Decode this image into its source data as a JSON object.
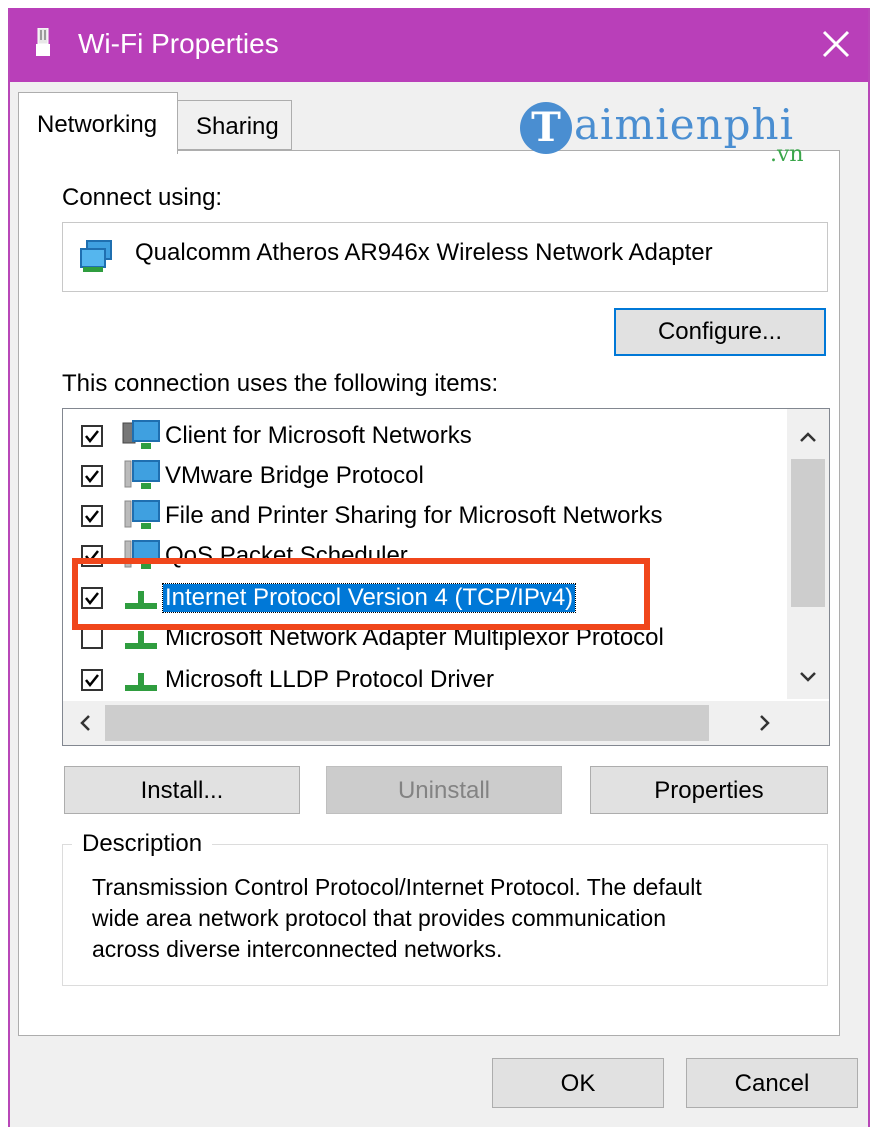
{
  "window": {
    "title": "Wi-Fi Properties",
    "accent_color": "#b93fb9"
  },
  "tabs": [
    {
      "label": "Networking",
      "active": true
    },
    {
      "label": "Sharing",
      "active": false
    }
  ],
  "watermark": {
    "initial": "T",
    "text": "aimienphi",
    "suffix": ".vn"
  },
  "connect": {
    "label": "Connect using:",
    "adapter": "Qualcomm Atheros AR946x Wireless Network Adapter",
    "adapter_icon": "network-adapter-icon",
    "configure_label": "Configure..."
  },
  "items": {
    "label": "This connection uses the following items:",
    "list": [
      {
        "text": "Client for Microsoft Networks",
        "checked": true,
        "icon": "network-client-icon",
        "selected": false
      },
      {
        "text": "VMware Bridge Protocol",
        "checked": true,
        "icon": "network-service-icon",
        "selected": false
      },
      {
        "text": "File and Printer Sharing for Microsoft Networks",
        "checked": true,
        "icon": "network-service-icon",
        "selected": false
      },
      {
        "text": "QoS Packet Scheduler",
        "checked": true,
        "icon": "network-service-icon",
        "selected": false
      },
      {
        "text": "Internet Protocol Version 4 (TCP/IPv4)",
        "checked": true,
        "icon": "protocol-icon",
        "selected": true
      },
      {
        "text": "Microsoft Network Adapter Multiplexor Protocol",
        "checked": false,
        "icon": "protocol-icon",
        "selected": false
      },
      {
        "text": "Microsoft LLDP Protocol Driver",
        "checked": true,
        "icon": "protocol-icon",
        "selected": false
      }
    ]
  },
  "actions": {
    "install_label": "Install...",
    "uninstall_label": "Uninstall",
    "properties_label": "Properties"
  },
  "description": {
    "legend": "Description",
    "lines": [
      "Transmission Control Protocol/Internet Protocol. The default",
      "wide area network protocol that provides communication",
      "across diverse interconnected networks."
    ]
  },
  "footer": {
    "ok_label": "OK",
    "cancel_label": "Cancel"
  },
  "colors": {
    "selection": "#0078d7",
    "annotation": "#f0461b"
  }
}
